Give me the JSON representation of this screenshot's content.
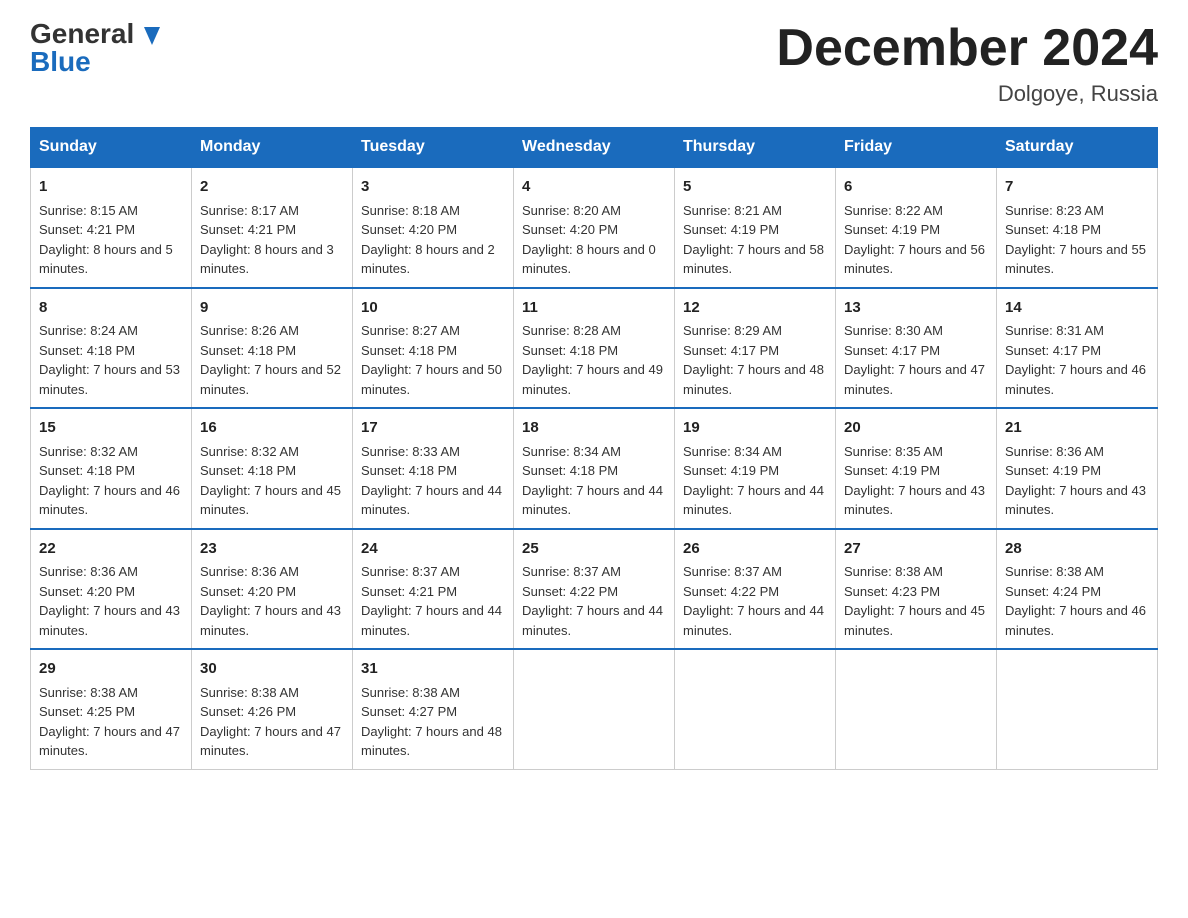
{
  "header": {
    "logo_line1": "General",
    "logo_line2": "Blue",
    "month_title": "December 2024",
    "location": "Dolgoye, Russia"
  },
  "weekdays": [
    "Sunday",
    "Monday",
    "Tuesday",
    "Wednesday",
    "Thursday",
    "Friday",
    "Saturday"
  ],
  "weeks": [
    [
      {
        "day": "1",
        "sunrise": "8:15 AM",
        "sunset": "4:21 PM",
        "daylight": "8 hours and 5 minutes."
      },
      {
        "day": "2",
        "sunrise": "8:17 AM",
        "sunset": "4:21 PM",
        "daylight": "8 hours and 3 minutes."
      },
      {
        "day": "3",
        "sunrise": "8:18 AM",
        "sunset": "4:20 PM",
        "daylight": "8 hours and 2 minutes."
      },
      {
        "day": "4",
        "sunrise": "8:20 AM",
        "sunset": "4:20 PM",
        "daylight": "8 hours and 0 minutes."
      },
      {
        "day": "5",
        "sunrise": "8:21 AM",
        "sunset": "4:19 PM",
        "daylight": "7 hours and 58 minutes."
      },
      {
        "day": "6",
        "sunrise": "8:22 AM",
        "sunset": "4:19 PM",
        "daylight": "7 hours and 56 minutes."
      },
      {
        "day": "7",
        "sunrise": "8:23 AM",
        "sunset": "4:18 PM",
        "daylight": "7 hours and 55 minutes."
      }
    ],
    [
      {
        "day": "8",
        "sunrise": "8:24 AM",
        "sunset": "4:18 PM",
        "daylight": "7 hours and 53 minutes."
      },
      {
        "day": "9",
        "sunrise": "8:26 AM",
        "sunset": "4:18 PM",
        "daylight": "7 hours and 52 minutes."
      },
      {
        "day": "10",
        "sunrise": "8:27 AM",
        "sunset": "4:18 PM",
        "daylight": "7 hours and 50 minutes."
      },
      {
        "day": "11",
        "sunrise": "8:28 AM",
        "sunset": "4:18 PM",
        "daylight": "7 hours and 49 minutes."
      },
      {
        "day": "12",
        "sunrise": "8:29 AM",
        "sunset": "4:17 PM",
        "daylight": "7 hours and 48 minutes."
      },
      {
        "day": "13",
        "sunrise": "8:30 AM",
        "sunset": "4:17 PM",
        "daylight": "7 hours and 47 minutes."
      },
      {
        "day": "14",
        "sunrise": "8:31 AM",
        "sunset": "4:17 PM",
        "daylight": "7 hours and 46 minutes."
      }
    ],
    [
      {
        "day": "15",
        "sunrise": "8:32 AM",
        "sunset": "4:18 PM",
        "daylight": "7 hours and 46 minutes."
      },
      {
        "day": "16",
        "sunrise": "8:32 AM",
        "sunset": "4:18 PM",
        "daylight": "7 hours and 45 minutes."
      },
      {
        "day": "17",
        "sunrise": "8:33 AM",
        "sunset": "4:18 PM",
        "daylight": "7 hours and 44 minutes."
      },
      {
        "day": "18",
        "sunrise": "8:34 AM",
        "sunset": "4:18 PM",
        "daylight": "7 hours and 44 minutes."
      },
      {
        "day": "19",
        "sunrise": "8:34 AM",
        "sunset": "4:19 PM",
        "daylight": "7 hours and 44 minutes."
      },
      {
        "day": "20",
        "sunrise": "8:35 AM",
        "sunset": "4:19 PM",
        "daylight": "7 hours and 43 minutes."
      },
      {
        "day": "21",
        "sunrise": "8:36 AM",
        "sunset": "4:19 PM",
        "daylight": "7 hours and 43 minutes."
      }
    ],
    [
      {
        "day": "22",
        "sunrise": "8:36 AM",
        "sunset": "4:20 PM",
        "daylight": "7 hours and 43 minutes."
      },
      {
        "day": "23",
        "sunrise": "8:36 AM",
        "sunset": "4:20 PM",
        "daylight": "7 hours and 43 minutes."
      },
      {
        "day": "24",
        "sunrise": "8:37 AM",
        "sunset": "4:21 PM",
        "daylight": "7 hours and 44 minutes."
      },
      {
        "day": "25",
        "sunrise": "8:37 AM",
        "sunset": "4:22 PM",
        "daylight": "7 hours and 44 minutes."
      },
      {
        "day": "26",
        "sunrise": "8:37 AM",
        "sunset": "4:22 PM",
        "daylight": "7 hours and 44 minutes."
      },
      {
        "day": "27",
        "sunrise": "8:38 AM",
        "sunset": "4:23 PM",
        "daylight": "7 hours and 45 minutes."
      },
      {
        "day": "28",
        "sunrise": "8:38 AM",
        "sunset": "4:24 PM",
        "daylight": "7 hours and 46 minutes."
      }
    ],
    [
      {
        "day": "29",
        "sunrise": "8:38 AM",
        "sunset": "4:25 PM",
        "daylight": "7 hours and 47 minutes."
      },
      {
        "day": "30",
        "sunrise": "8:38 AM",
        "sunset": "4:26 PM",
        "daylight": "7 hours and 47 minutes."
      },
      {
        "day": "31",
        "sunrise": "8:38 AM",
        "sunset": "4:27 PM",
        "daylight": "7 hours and 48 minutes."
      },
      null,
      null,
      null,
      null
    ]
  ]
}
